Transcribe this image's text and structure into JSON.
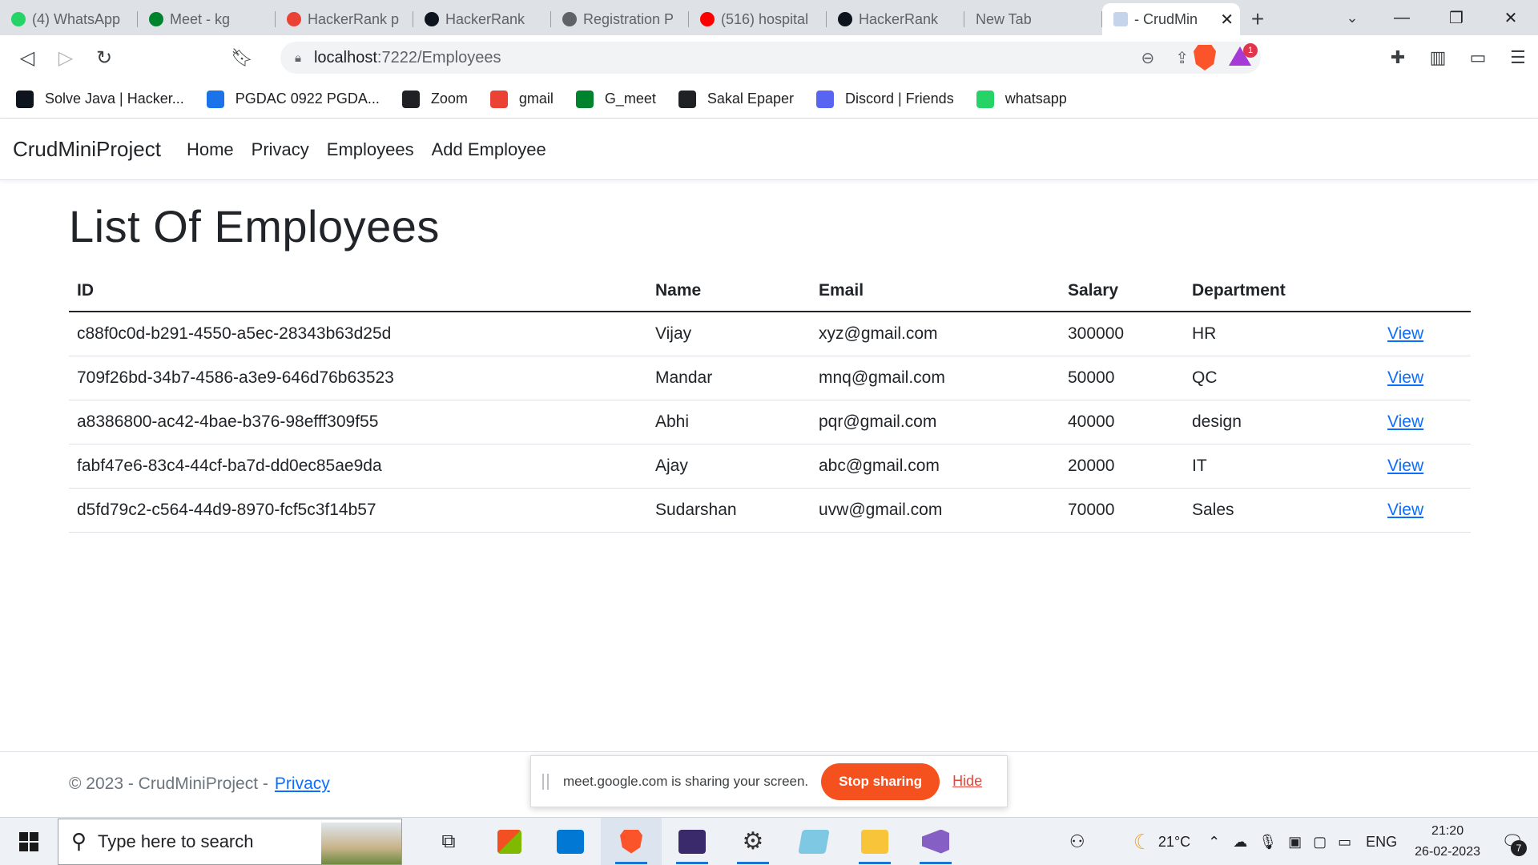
{
  "browser": {
    "tabs": [
      {
        "title": "(4) WhatsApp",
        "icon": "whatsapp-icon",
        "color": "#25d366"
      },
      {
        "title": "Meet - kg",
        "icon": "google-meet-icon",
        "color": "#00832d"
      },
      {
        "title": "HackerRank p",
        "icon": "gmail-icon",
        "color": "#ea4335"
      },
      {
        "title": "HackerRank",
        "icon": "hackerrank-icon",
        "color": "#0e141e"
      },
      {
        "title": "Registration P",
        "icon": "globe-icon",
        "color": "#5f6368"
      },
      {
        "title": "(516) hospital",
        "icon": "youtube-icon",
        "color": "#ff0000"
      },
      {
        "title": "HackerRank",
        "icon": "hackerrank-icon",
        "color": "#0e141e"
      },
      {
        "title": "New Tab",
        "icon": "",
        "color": ""
      }
    ],
    "active_tab": {
      "title": "- CrudMin",
      "icon": "page-icon"
    },
    "url_host": "localhost",
    "url_path": ":7222/Employees",
    "bookmarks": [
      {
        "label": "Solve Java | Hacker...",
        "icon": "hackerrank-icon",
        "color": "#0e141e"
      },
      {
        "label": "PGDAC 0922 PGDA...",
        "icon": "contact-icon",
        "color": "#1a73e8"
      },
      {
        "label": "Zoom",
        "icon": "globe-icon",
        "color": "#202124"
      },
      {
        "label": "gmail",
        "icon": "gmail-icon",
        "color": "#ea4335"
      },
      {
        "label": "G_meet",
        "icon": "google-meet-icon",
        "color": "#00832d"
      },
      {
        "label": "Sakal Epaper",
        "icon": "globe-icon",
        "color": "#202124"
      },
      {
        "label": "Discord | Friends",
        "icon": "discord-icon",
        "color": "#5865f2"
      },
      {
        "label": "whatsapp",
        "icon": "whatsapp-icon",
        "color": "#25d366"
      }
    ]
  },
  "app": {
    "brand": "CrudMiniProject",
    "nav": [
      "Home",
      "Privacy",
      "Employees",
      "Add Employee"
    ],
    "page_title": "List Of Employees",
    "columns": [
      "ID",
      "Name",
      "Email",
      "Salary",
      "Department"
    ],
    "employees": [
      {
        "id": "c88f0c0d-b291-4550-a5ec-28343b63d25d",
        "name": "Vijay",
        "email": "xyz@gmail.com",
        "salary": "300000",
        "department": "HR",
        "action": "View"
      },
      {
        "id": "709f26bd-34b7-4586-a3e9-646d76b63523",
        "name": "Mandar",
        "email": "mnq@gmail.com",
        "salary": "50000",
        "department": "QC",
        "action": "View"
      },
      {
        "id": "a8386800-ac42-4bae-b376-98efff309f55",
        "name": "Abhi",
        "email": "pqr@gmail.com",
        "salary": "40000",
        "department": "design",
        "action": "View"
      },
      {
        "id": "fabf47e6-83c4-44cf-ba7d-dd0ec85ae9da",
        "name": "Ajay",
        "email": "abc@gmail.com",
        "salary": "20000",
        "department": "IT",
        "action": "View"
      },
      {
        "id": "d5fd79c2-c564-44d9-8970-fcf5c3f14b57",
        "name": "Sudarshan",
        "email": "uvw@gmail.com",
        "salary": "70000",
        "department": "Sales",
        "action": "View"
      }
    ],
    "footer_text": "© 2023 - CrudMiniProject -",
    "footer_link": "Privacy"
  },
  "share_bar": {
    "message": "meet.google.com is sharing your screen.",
    "stop_label": "Stop sharing",
    "hide_label": "Hide"
  },
  "taskbar": {
    "search_placeholder": "Type here to search",
    "weather": "21°C",
    "language": "ENG",
    "time": "21:20",
    "date": "26-02-2023",
    "notifications": "7"
  }
}
